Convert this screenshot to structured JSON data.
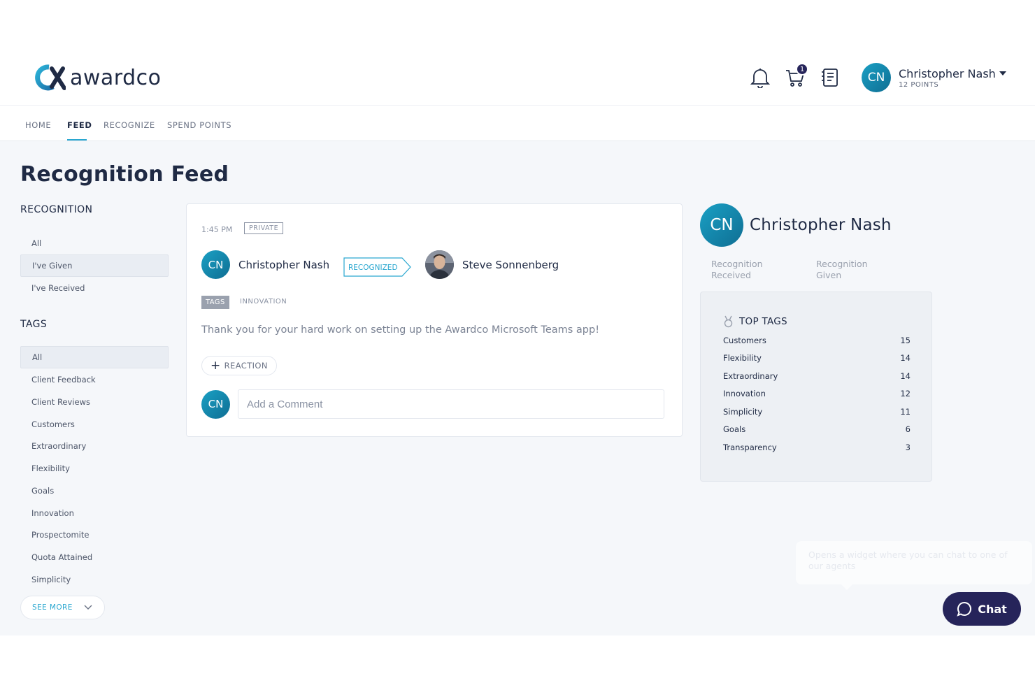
{
  "brand": {
    "name": "awardco",
    "accent": "#2aa7d0",
    "dark": "#1f2a44",
    "chat_bg": "#26245a"
  },
  "header": {
    "cart_count": "1",
    "user": {
      "initials": "CN",
      "name": "Christopher Nash",
      "points": "12 POINTS"
    },
    "icons": [
      "bell-icon",
      "cart-icon",
      "catalog-icon"
    ]
  },
  "nav": {
    "items": [
      "HOME",
      "FEED",
      "RECOGNIZE",
      "SPEND POINTS"
    ],
    "active": "FEED"
  },
  "page": {
    "title": "Recognition Feed"
  },
  "sidebar": {
    "recognition_title": "RECOGNITION",
    "recognition_filters": [
      "All",
      "I've Given",
      "I've Received"
    ],
    "tags_title": "TAGS",
    "tag_filters": [
      "All",
      "Client Feedback",
      "Client Reviews",
      "Customers",
      "Extraordinary",
      "Flexibility",
      "Goals",
      "Innovation",
      "Prospectomite",
      "Quota Attained",
      "Simplicity"
    ],
    "see_more": "SEE MORE"
  },
  "post": {
    "time": "1:45 PM",
    "visibility": "PRIVATE",
    "giver": {
      "initials": "CN",
      "name": "Christopher Nash"
    },
    "action": "RECOGNIZED",
    "receiver": {
      "name": "Steve Sonnenberg"
    },
    "tags_label": "TAGS",
    "tag": "INNOVATION",
    "message": "Thank you for your hard work on setting up the Awardco Microsoft Teams app!",
    "reaction_label": "REACTION",
    "commenter_initials": "CN",
    "comment_placeholder": "Add a Comment"
  },
  "profile": {
    "initials": "CN",
    "name": "Christopher Nash",
    "stats": [
      "Recognition Received",
      "Recognition Given"
    ],
    "top_tags_title": "TOP TAGS",
    "top_tags": [
      {
        "name": "Customers",
        "count": "15"
      },
      {
        "name": "Flexibility",
        "count": "14"
      },
      {
        "name": "Extraordinary",
        "count": "14"
      },
      {
        "name": "Innovation",
        "count": "12"
      },
      {
        "name": "Simplicity",
        "count": "11"
      },
      {
        "name": "Goals",
        "count": "6"
      },
      {
        "name": "Transparency",
        "count": "3"
      }
    ]
  },
  "chat": {
    "tooltip": "Opens a widget where you can chat to one of our agents",
    "label": "Chat"
  }
}
